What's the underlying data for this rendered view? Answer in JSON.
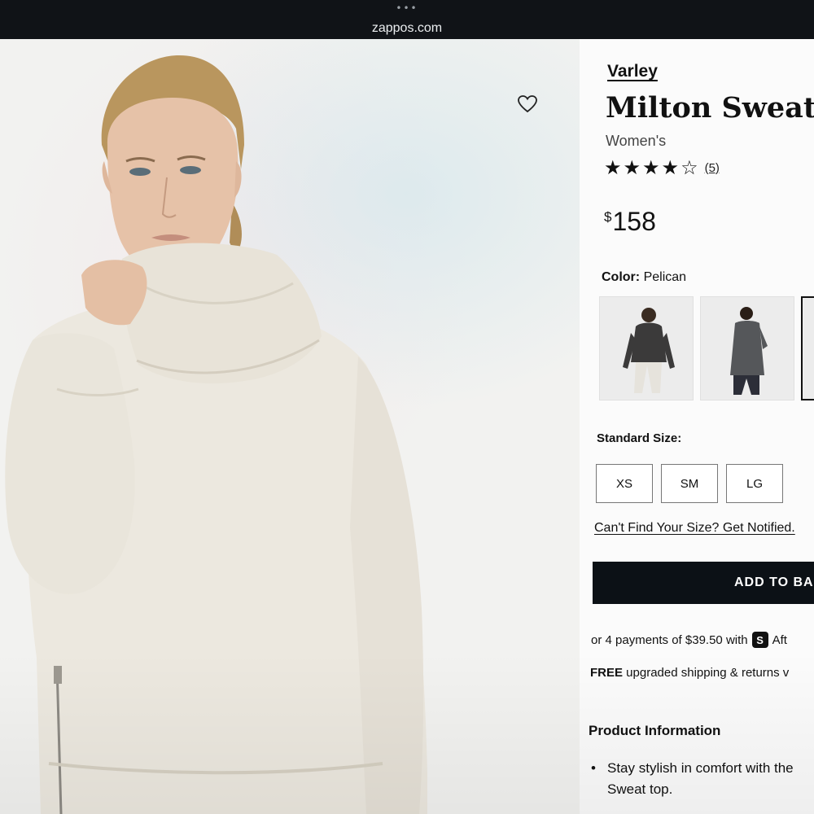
{
  "browser": {
    "dots": "•••",
    "url": "zappos.com"
  },
  "product": {
    "brand": "Varley",
    "title": "Milton Sweat",
    "gender": "Women's",
    "rating": 4,
    "rating_max": 5,
    "review_count": "(5)",
    "price_currency": "$",
    "price_amount": "158",
    "color_label": "Color:",
    "color_value": "Pelican",
    "swatches": [
      {
        "name": "dark-charcoal"
      },
      {
        "name": "slate-gray"
      },
      {
        "name": "selected-pelican"
      }
    ],
    "size_label": "Standard Size:",
    "sizes": [
      "XS",
      "SM",
      "LG"
    ],
    "notify_text": "Can't Find Your Size? Get Notified.",
    "add_to_bag": "ADD TO BA",
    "payments_text": "or 4 payments of $39.50 with",
    "payments_badge": "S",
    "payments_provider": "Aft",
    "shipping_bold": "FREE",
    "shipping_rest": " upgraded shipping & returns v",
    "info_title": "Product Information",
    "bullet_bullet": "•",
    "bullet_line1": "Stay stylish in comfort with the",
    "bullet_line2": "Sweat top."
  },
  "icons": {
    "favorite": "heart-icon",
    "star": "star-icon"
  },
  "colors": {
    "button_bg": "#0c1116",
    "sweater": "#ece8df"
  }
}
